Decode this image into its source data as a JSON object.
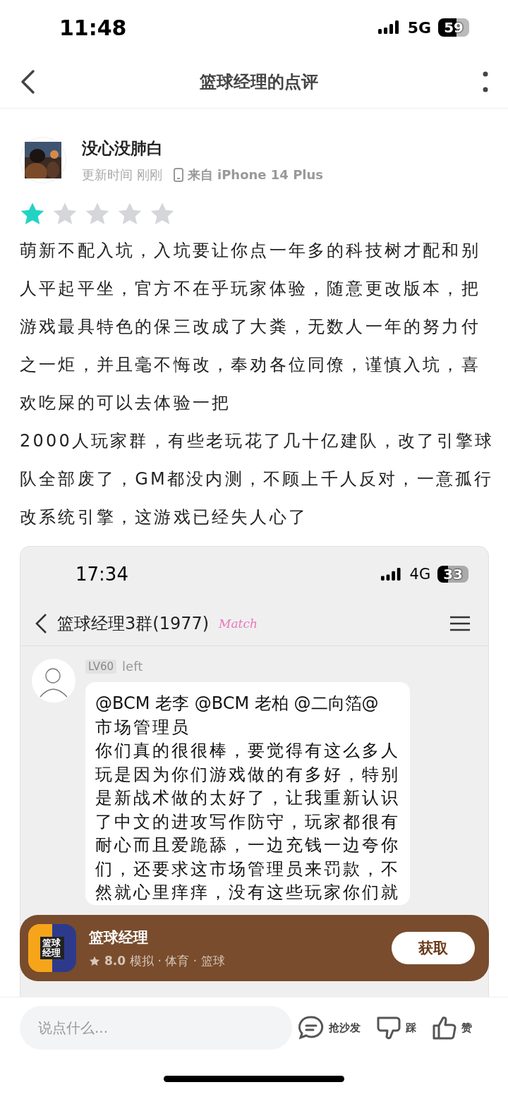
{
  "status_bar": {
    "time": "11:48",
    "network": "5G",
    "battery": "59"
  },
  "nav": {
    "title": "篮球经理的点评"
  },
  "review": {
    "author": "没心没肺白",
    "updated_label": "更新时间 刚刚",
    "device": "来自 iPhone 14 Plus",
    "stars": 1,
    "paragraphs": [
      "萌新不配入坑，入坑要让你点一年多的科技树才配和别人平起平坐，官方不在乎玩家体验，随意更改版本，把游戏最具特色的保三改成了大粪，无数人一年的努力付之一炬，并且毫不悔改，奉劝各位同僚，谨慎入坑，喜欢吃屎的可以去体验一把",
      "2000人玩家群，有些老玩花了几十亿建队，改了引擎球队全部废了，GM都没内测，不顾上千人反对，一意孤行改系统引擎，这游戏已经失人心了"
    ]
  },
  "attachment": {
    "status_bar": {
      "time": "17:34",
      "network": "4G",
      "battery": "33"
    },
    "chat_title": "篮球经理3群(1977)",
    "chat_tag": "Match",
    "message": {
      "badge": "LV60",
      "sender": "left",
      "lines": [
        "@BCM 老李 @BCM 老柏 @二向箔@",
        "市场管理员",
        "你们真的很很棒，要觉得有这么多人玩是因为你们游戏做的有多好，特别是新战术做的太好了，让我重新认识了中文的进攻写作防守，玩家都很有耐心而且爱跪舔，一边充钱一边夸你们，还要求这市场管理员来罚款，不然就心里痒痒，没有这些玩家你们就"
      ]
    }
  },
  "app_card": {
    "icon_label": "篮球经理",
    "name": "篮球经理",
    "rating": "8.0",
    "tags": "模拟 · 体育 · 篮球",
    "button": "获取"
  },
  "bottom_bar": {
    "placeholder": "说点什么...",
    "actions": [
      {
        "kind": "comment",
        "label": "抢沙发"
      },
      {
        "kind": "dislike",
        "label": "踩"
      },
      {
        "kind": "like",
        "label": "赞"
      }
    ]
  }
}
